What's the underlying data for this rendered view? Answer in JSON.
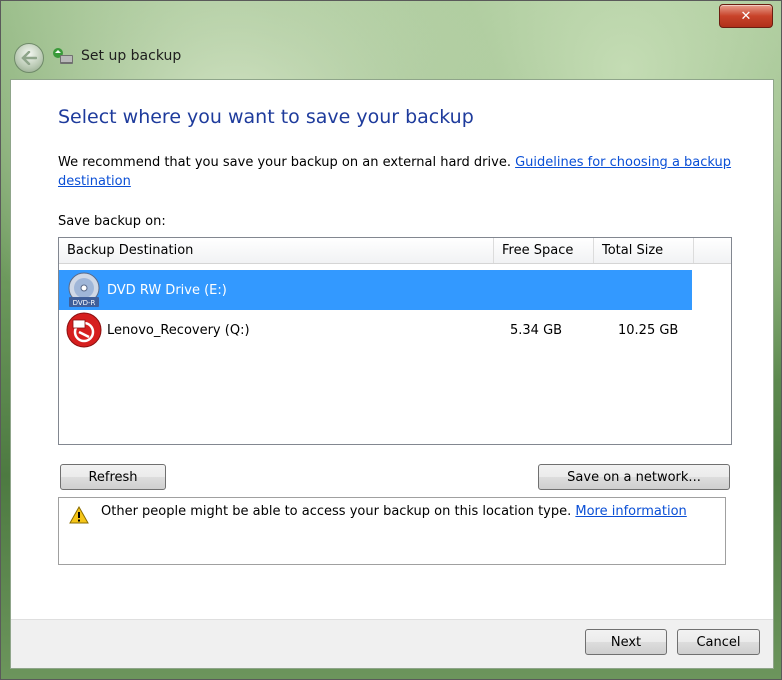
{
  "window": {
    "title": "Set up backup",
    "close_glyph": "✕"
  },
  "page": {
    "heading": "Select where you want to save your backup",
    "recommend_text": "We recommend that you save your backup on an external hard drive. ",
    "guidelines_link": "Guidelines for choosing a backup destination",
    "save_label": "Save backup on:"
  },
  "table": {
    "headers": [
      "Backup Destination",
      "Free Space",
      "Total Size"
    ],
    "rows": [
      {
        "name": "DVD RW Drive (E:)",
        "free": "",
        "total": "",
        "icon": "dvd-icon",
        "selected": true
      },
      {
        "name": "Lenovo_Recovery (Q:)",
        "free": "5.34 GB",
        "total": "10.25 GB",
        "icon": "recovery-drive-icon",
        "selected": false
      }
    ]
  },
  "buttons": {
    "refresh": "Refresh",
    "network": "Save on a network...",
    "next": "Next",
    "cancel": "Cancel"
  },
  "warning": {
    "text": "Other people might be able to access your backup on this location type. ",
    "link": "More information"
  },
  "colors": {
    "heading": "#1e3b9c",
    "link": "#0a4fd6",
    "selection": "#3399ff"
  }
}
